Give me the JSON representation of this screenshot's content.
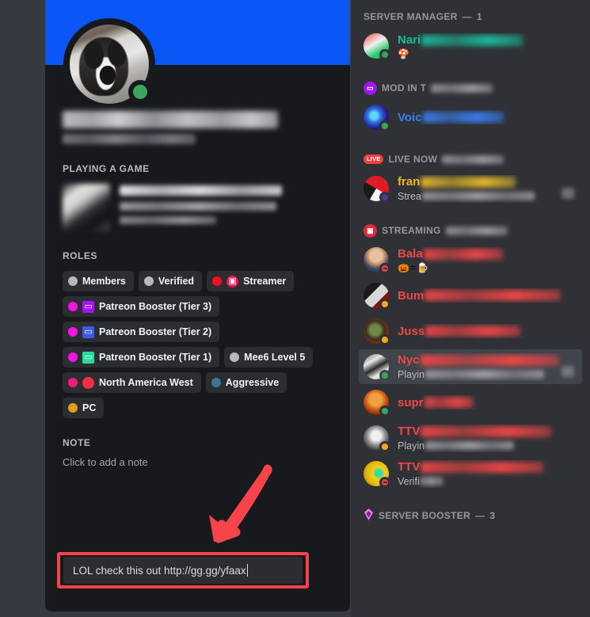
{
  "colors": {
    "banner": "#0b57f5",
    "card_bg": "#18191c",
    "app_bg": "#36393f",
    "member_list_bg": "#2f3136",
    "pill_bg": "#2b2d31",
    "online": "#3ba55d",
    "idle": "#faa81a",
    "dnd": "#ed4245",
    "annotation_red": "#f7444a",
    "live_badge": "#f23f42",
    "booster_pink": "#ff73fa"
  },
  "profile": {
    "avatar": {
      "name": "husky-avatar",
      "status": "online"
    },
    "username_redacted": true,
    "tag_redacted": true,
    "activity_heading": "PLAYING A GAME",
    "activity": {
      "title_redacted": true,
      "detail_redacted": true,
      "elapsed_redacted": true
    },
    "roles_heading": "ROLES",
    "roles": [
      {
        "label": "Members",
        "dot": "#b5b9be",
        "emoji": null
      },
      {
        "label": "Verified",
        "dot": "#b5b9be",
        "emoji": null
      },
      {
        "label": "Streamer",
        "dot": "#fc0d1b",
        "emoji": "camera",
        "emoji_bg": "#e8174f",
        "emoji_glyph": "▣",
        "emoji_shape": "circle"
      },
      {
        "label": "Patreon Booster (Tier 3)",
        "dot": "#f613e8",
        "emoji": "controller",
        "emoji_bg": "#a016f0",
        "emoji_glyph": "▭",
        "emoji_shape": "square"
      },
      {
        "label": "Patreon Booster (Tier 2)",
        "dot": "#f613e8",
        "emoji": "controller",
        "emoji_bg": "#3d5ce0",
        "emoji_glyph": "▭",
        "emoji_shape": "square"
      },
      {
        "label": "Patreon Booster (Tier 1)",
        "dot": "#f613e8",
        "emoji": "controller",
        "emoji_bg": "#2ddb9e",
        "emoji_glyph": "▭",
        "emoji_shape": "square"
      },
      {
        "label": "Mee6 Level 5",
        "dot": "#b5b9be",
        "emoji": null
      },
      {
        "label": "North America West",
        "dot": "#f5197d",
        "emoji": "red-circle",
        "emoji_bg": "#f03040",
        "emoji_glyph": " ",
        "emoji_shape": "circle"
      },
      {
        "label": "Aggressive",
        "dot": "#3a7696",
        "emoji": null
      },
      {
        "label": "PC",
        "dot": "#e0a014",
        "emoji": null
      }
    ],
    "note_heading": "NOTE",
    "note_placeholder": "Click to add a note",
    "note_value": "LOL check this out http://gg.gg/yfaax"
  },
  "annotations": {
    "arrow": {
      "name": "red-arrow",
      "points_to": "note-input"
    },
    "highlight_box": {
      "name": "note-highlight-box",
      "target": "note-input"
    }
  },
  "member_list": {
    "groups": [
      {
        "id": "server-manager",
        "label": "SERVER MANAGER",
        "separator": "—",
        "count": "1",
        "icon": null,
        "label_redacted": false,
        "members": [
          {
            "name_prefix": "Nari",
            "name_color": "#1abc9c",
            "name_blur_width": 128,
            "avatar_name": "mushroom-avatar",
            "avatar_bg": "linear-gradient(150deg,#e84c3d 0%,#f0f0f0 42%,#2ecc71 70%,#27ae60 100%)",
            "status": "online",
            "sub_text": null,
            "emoji_line": "🍄",
            "sub_blur_width": 0,
            "trailing_chip": false
          }
        ]
      },
      {
        "id": "mod-in",
        "label": "MOD IN T",
        "separator": "",
        "count": "",
        "icon": "game-controller-icon",
        "icon_bg": "#a016f0",
        "icon_glyph": "▭",
        "label_redacted": true,
        "members": [
          {
            "name_prefix": "Voic",
            "name_color": "#3a7ff5",
            "name_blur_width": 102,
            "avatar_name": "blue-energy-avatar",
            "avatar_bg": "radial-gradient(circle at 42% 44%, #63d6ff 0 16%, #2b6fe0 34%, #2a1a8c 62%, #0d0a2e 100%)",
            "status": "online",
            "sub_text": null,
            "emoji_line": null,
            "sub_blur_width": 0,
            "trailing_chip": false
          }
        ]
      },
      {
        "id": "live-now",
        "label": "LIVE NOW",
        "separator": "",
        "count": "",
        "icon": "live-badge",
        "icon_text": "LIVE",
        "label_redacted": true,
        "members": [
          {
            "name_prefix": "fran",
            "name_color": "#e8bc2a",
            "name_blur_width": 120,
            "avatar_name": "pokeball-avatar",
            "avatar_bg": "conic-gradient(from 30deg,#e01b24 0 25%,#f4f4f4 25% 50%,#1b1b1b 50% 75%,#e01b24 75% 100%)",
            "status": "streaming",
            "sub_text": "Strea",
            "sub_blur_width": 142,
            "emoji_line": null,
            "trailing_chip": true
          }
        ]
      },
      {
        "id": "streaming",
        "label": "STREAMING",
        "separator": "",
        "count": "",
        "icon": "camera-icon",
        "icon_bg": "#e02a36",
        "icon_glyph": "▣",
        "label_redacted": true,
        "members": [
          {
            "name_prefix": "Bala",
            "name_color": "#f04747",
            "name_blur_width": 100,
            "avatar_name": "bald-man-avatar",
            "avatar_bg": "radial-gradient(circle at 50% 34%, #e8c2a0 0 28%, #c9976c 40%, #3d4a63 62%, #16202e 100%)",
            "status": "dnd",
            "sub_text": null,
            "emoji_line": "🎃=🍺",
            "sub_blur_width": 0,
            "trailing_chip": false
          },
          {
            "name_prefix": "Bum",
            "name_color": "#f04747",
            "name_blur_width": 172,
            "avatar_name": "wolf-logo-avatar",
            "avatar_bg": "linear-gradient(135deg,#1a1a1a 0 38%,#d8d8d8 38% 66%,#8a1216 66% 100%)",
            "status": "idle",
            "sub_text": null,
            "emoji_line": null,
            "sub_blur_width": 0,
            "trailing_chip": false
          },
          {
            "name_prefix": "Juss",
            "name_color": "#f04747",
            "name_blur_width": 120,
            "avatar_name": "soldier-avatar",
            "avatar_bg": "radial-gradient(circle at 46% 46%, #6f8a45 0 26%, #3b2f22 48%, #8a2b12 72%, #140d08 100%)",
            "status": "idle",
            "sub_text": null,
            "emoji_line": null,
            "sub_blur_width": 0,
            "trailing_chip": false
          },
          {
            "name_prefix": "Nyc",
            "name_color": "#f04747",
            "name_blur_width": 175,
            "avatar_name": "husky-avatar",
            "avatar_bg": "linear-gradient(150deg,#6f655b 0%,#e9e8e6 30%,#2a2826 52%,#f1f0ee 74%,#8f8b86 100%)",
            "status": "online",
            "sub_text": "Playin",
            "sub_blur_width": 150,
            "emoji_line": null,
            "trailing_chip": true,
            "active": true
          },
          {
            "name_prefix": "supr",
            "name_color": "#f04747",
            "name_blur_width": 62,
            "avatar_name": "orange-fighter-avatar",
            "avatar_bg": "radial-gradient(circle at 48% 40%, #f0a23c 0 30%, #c8541a 52%, #5e1d06 82%, #180800 100%)",
            "status": "online",
            "sub_text": null,
            "emoji_line": null,
            "sub_blur_width": 0,
            "trailing_chip": false
          },
          {
            "name_prefix": "TTV",
            "name_color": "#f04747",
            "name_blur_width": 165,
            "avatar_name": "grayscale-portrait-avatar",
            "avatar_bg": "radial-gradient(circle at 50% 42%, #f0f0f0 0 24%, #8e8e8e 48%, #3a3a3a 74%, #101010 100%)",
            "status": "idle",
            "sub_text": "Playin",
            "sub_blur_width": 112,
            "emoji_line": null,
            "trailing_chip": false
          },
          {
            "name_prefix": "TTV",
            "name_color": "#f04747",
            "name_blur_width": 155,
            "avatar_name": "yellow-character-avatar",
            "avatar_bg": "radial-gradient(circle at 60% 48%, #2de0a0 0 16%, #f2cf1b 30%, #e0b40c 62%, #7a5d05 100%)",
            "status": "dnd",
            "sub_text": "Verifi",
            "sub_blur_width": 28,
            "emoji_line": null,
            "trailing_chip": false
          }
        ]
      },
      {
        "id": "server-booster",
        "label": "SERVER BOOSTER",
        "separator": "—",
        "count": "3",
        "icon": "boost-diamond-icon",
        "label_redacted": false,
        "members": []
      }
    ]
  }
}
